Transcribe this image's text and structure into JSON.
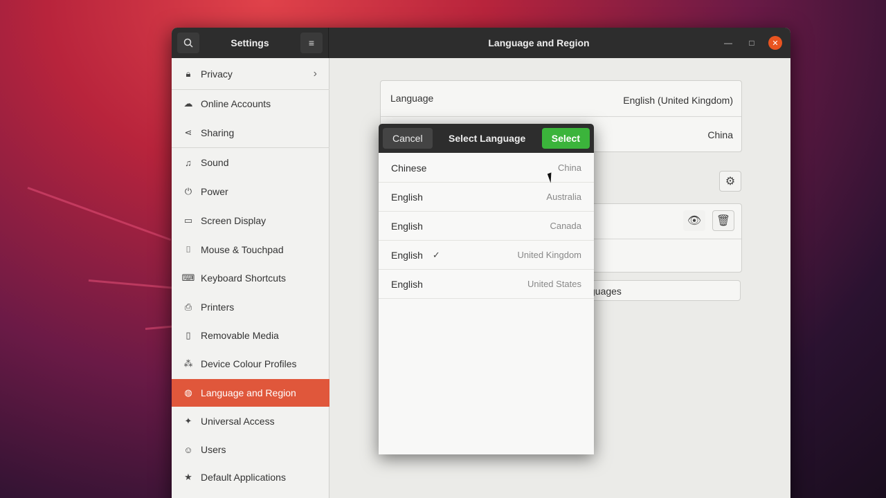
{
  "titlebar": {
    "app_title": "Settings",
    "page_title": "Language and Region"
  },
  "sidebar": {
    "items": [
      {
        "label": "Privacy",
        "icon": "lock-icon"
      },
      {
        "label": "Online Accounts",
        "icon": "cloud-icon"
      },
      {
        "label": "Sharing",
        "icon": "share-icon"
      },
      {
        "label": "Sound",
        "icon": "music-note-icon"
      },
      {
        "label": "Power",
        "icon": "power-icon"
      },
      {
        "label": "Screen Display",
        "icon": "display-icon"
      },
      {
        "label": "Mouse & Touchpad",
        "icon": "mouse-icon"
      },
      {
        "label": "Keyboard Shortcuts",
        "icon": "keyboard-icon"
      },
      {
        "label": "Printers",
        "icon": "printer-icon"
      },
      {
        "label": "Removable Media",
        "icon": "usb-icon"
      },
      {
        "label": "Device Colour Profiles",
        "icon": "color-profile-icon"
      },
      {
        "label": "Language and Region",
        "icon": "globe-icon",
        "active": true
      },
      {
        "label": "Universal Access",
        "icon": "accessibility-icon"
      },
      {
        "label": "Users",
        "icon": "users-icon"
      },
      {
        "label": "Default Applications",
        "icon": "star-icon"
      }
    ]
  },
  "main": {
    "language_label": "Language",
    "language_value": "English (United Kingdom)",
    "formats_value": "China",
    "manage_languages_partial": "guages"
  },
  "dialog": {
    "title": "Select Language",
    "cancel_label": "Cancel",
    "select_label": "Select",
    "languages": [
      {
        "name": "Chinese",
        "region": "China",
        "selected": false
      },
      {
        "name": "English",
        "region": "Australia",
        "selected": false
      },
      {
        "name": "English",
        "region": "Canada",
        "selected": false
      },
      {
        "name": "English",
        "region": "United Kingdom",
        "selected": true
      },
      {
        "name": "English",
        "region": "United States",
        "selected": false
      }
    ]
  },
  "colors": {
    "accent": "#e0573b",
    "select_button": "#3bb43b",
    "titlebar": "#2d2d2d",
    "close_button": "#e95420"
  }
}
